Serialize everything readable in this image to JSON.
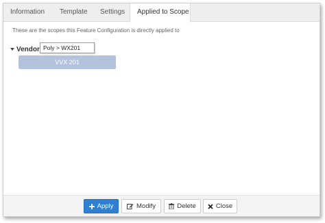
{
  "tabs": [
    {
      "label": "Information"
    },
    {
      "label": "Template"
    },
    {
      "label": "Settings"
    },
    {
      "label": "Applied to Scope"
    }
  ],
  "active_tab": "Applied to Scope",
  "description": "These are the scopes this Feature Configuration is directly applied to",
  "tree": {
    "vendor_label": "Vendor",
    "expanded": true,
    "tooltip": "Poly > WX201",
    "scope_item": "VVX 201"
  },
  "footer": {
    "apply_label": "Apply",
    "modify_label": "Modify",
    "delete_label": "Delete",
    "close_label": "Close"
  },
  "icons": {
    "apply": "plus-icon",
    "modify": "edit-icon",
    "delete": "trash-icon",
    "close": "close-icon"
  },
  "colors": {
    "primary_button": "#2f7fd3",
    "scope_item_bg": "#b3c3dd",
    "tab_bar_bg": "#eeeeee",
    "footer_bg": "#f3f3f3"
  }
}
